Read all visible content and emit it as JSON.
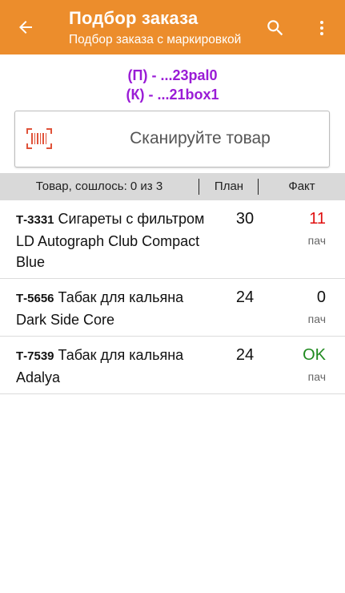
{
  "appbar": {
    "title": "Подбор заказа",
    "subtitle": "Подбор заказа с маркировкой",
    "color": "#ec8d2c"
  },
  "codes": {
    "pallet": "(П) - ...23pal0",
    "box": "(К) - ...21box1",
    "color": "#9a1cd6"
  },
  "scan": {
    "label": "Сканируйте товар",
    "icon": "barcode-scan-icon"
  },
  "table": {
    "headers": {
      "name": "Товар, сошлось: 0 из 3",
      "plan": "План",
      "fact": "Факт"
    },
    "rows": [
      {
        "code": "Т-3331",
        "name": "Сигареты с фильтром LD Autograph Club Compact Blue",
        "plan": "30",
        "fact": "11",
        "fact_color": "#e01010",
        "unit": "пач"
      },
      {
        "code": "Т-5656",
        "name": "Табак для кальяна Dark Side Core",
        "plan": "24",
        "fact": "0",
        "fact_color": "#111111",
        "unit": "пач"
      },
      {
        "code": "Т-7539",
        "name": "Табак для кальяна Adalya",
        "plan": "24",
        "fact": "OK",
        "fact_color": "#1f8a1f",
        "unit": "пач"
      }
    ]
  }
}
